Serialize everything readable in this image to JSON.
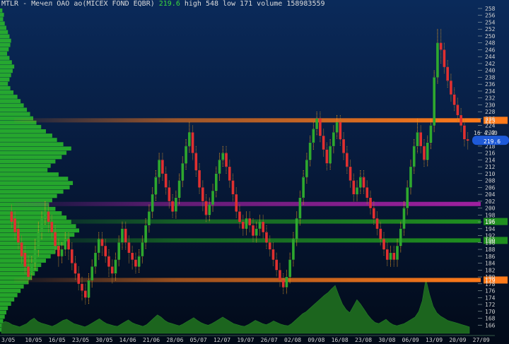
{
  "header": {
    "ticker": "MTLR",
    "name": "- Мечел ОАО ао(MICEX FOND EQBR)",
    "last": "219.6",
    "high": "high 548",
    "low": "low 171",
    "volume": "volume 158983559"
  },
  "colors": {
    "up": "#f0a020",
    "down": "#e03030",
    "line_orange": "#ff7a1a",
    "line_purple": "#a020a0",
    "line_green": "#1f8f1f",
    "volume_profile": "#2bbf2b",
    "volume_fill": "#1f6f1f",
    "axis_text": "#d0d0d0",
    "price_badge": "#1e5ad8"
  },
  "chart_data": {
    "type": "candlestick",
    "yaxis": {
      "min": 164,
      "max": 258,
      "ticks": [
        "166",
        "168",
        "170",
        "172",
        "174",
        "176",
        "178",
        "180",
        "182",
        "184",
        "186",
        "188",
        "190",
        "192",
        "194",
        "196",
        "198",
        "200",
        "202",
        "204",
        "206",
        "208",
        "210",
        "212",
        "214",
        "216",
        "218",
        "220",
        "222",
        "224",
        "226",
        "228",
        "230",
        "232",
        "234",
        "236",
        "238",
        "240",
        "242",
        "244",
        "246",
        "248",
        "250",
        "252",
        "254",
        "256",
        "258"
      ]
    },
    "xaxis": {
      "ticks": [
        "3/05",
        "10/05",
        "16/05",
        "23/05",
        "30/05",
        "14/06",
        "21/06",
        "28/06",
        "05/07",
        "12/07",
        "19/07",
        "26/07",
        "02/08",
        "09/08",
        "16/08",
        "23/08",
        "30/08",
        "06/09",
        "13/09",
        "20/09",
        "27/09"
      ]
    },
    "levels": [
      {
        "price": 225.5,
        "label": "225",
        "color": "orange"
      },
      {
        "price": 201.2,
        "label": "",
        "color": "purple"
      },
      {
        "price": 196.1,
        "label": "196",
        "color": "green"
      },
      {
        "price": 190.6,
        "label": "190",
        "color": "green"
      },
      {
        "price": 179.1,
        "label": "179",
        "color": "orange"
      }
    ],
    "last_price": "219.6",
    "price_badge_side_label": "16 4:40",
    "daily": [
      [
        199,
        196,
        201,
        194
      ],
      [
        197,
        193,
        199,
        191
      ],
      [
        194,
        190,
        196,
        188
      ],
      [
        190,
        186,
        192,
        184
      ],
      [
        187,
        183,
        189,
        181
      ],
      [
        183,
        180,
        186,
        178
      ],
      [
        181,
        184,
        186,
        179
      ],
      [
        184,
        188,
        191,
        182
      ],
      [
        188,
        193,
        196,
        186
      ],
      [
        193,
        197,
        199,
        191
      ],
      [
        197,
        199,
        202,
        195
      ],
      [
        199,
        196,
        201,
        193
      ],
      [
        196,
        193,
        198,
        191
      ],
      [
        193,
        189,
        195,
        187
      ],
      [
        189,
        186,
        191,
        183
      ],
      [
        186,
        188,
        190,
        184
      ],
      [
        188,
        191,
        193,
        186
      ],
      [
        191,
        188,
        193,
        185
      ],
      [
        188,
        184,
        190,
        182
      ],
      [
        184,
        181,
        186,
        179
      ],
      [
        181,
        178,
        183,
        176
      ],
      [
        178,
        176,
        180,
        173
      ],
      [
        176,
        174,
        178,
        172
      ],
      [
        174,
        179,
        181,
        172
      ],
      [
        179,
        183,
        185,
        177
      ],
      [
        183,
        187,
        189,
        181
      ],
      [
        187,
        191,
        193,
        185
      ],
      [
        191,
        189,
        193,
        186
      ],
      [
        189,
        186,
        191,
        184
      ],
      [
        186,
        183,
        188,
        180
      ],
      [
        183,
        181,
        185,
        178
      ],
      [
        181,
        185,
        187,
        179
      ],
      [
        185,
        190,
        192,
        183
      ],
      [
        190,
        194,
        196,
        188
      ],
      [
        194,
        190,
        196,
        188
      ],
      [
        190,
        187,
        192,
        184
      ],
      [
        187,
        185,
        189,
        182
      ],
      [
        185,
        183,
        187,
        181
      ],
      [
        183,
        186,
        188,
        181
      ],
      [
        186,
        190,
        192,
        184
      ],
      [
        190,
        195,
        197,
        188
      ],
      [
        195,
        199,
        201,
        193
      ],
      [
        199,
        204,
        206,
        197
      ],
      [
        204,
        209,
        211,
        202
      ],
      [
        209,
        214,
        216,
        207
      ],
      [
        214,
        210,
        216,
        208
      ],
      [
        210,
        206,
        212,
        204
      ],
      [
        206,
        202,
        208,
        200
      ],
      [
        202,
        199,
        204,
        197
      ],
      [
        199,
        203,
        205,
        197
      ],
      [
        203,
        208,
        210,
        201
      ],
      [
        208,
        213,
        215,
        206
      ],
      [
        213,
        218,
        220,
        211
      ],
      [
        218,
        222,
        225,
        216
      ],
      [
        222,
        216,
        224,
        214
      ],
      [
        216,
        211,
        218,
        209
      ],
      [
        211,
        206,
        213,
        204
      ],
      [
        206,
        202,
        208,
        199
      ],
      [
        202,
        198,
        204,
        196
      ],
      [
        198,
        201,
        203,
        196
      ],
      [
        201,
        205,
        207,
        199
      ],
      [
        205,
        210,
        212,
        203
      ],
      [
        210,
        214,
        216,
        208
      ],
      [
        214,
        216,
        218,
        212
      ],
      [
        216,
        212,
        218,
        210
      ],
      [
        212,
        208,
        214,
        206
      ],
      [
        208,
        204,
        210,
        202
      ],
      [
        204,
        199,
        206,
        197
      ],
      [
        199,
        196,
        201,
        194
      ],
      [
        196,
        194,
        198,
        192
      ],
      [
        194,
        197,
        199,
        192
      ],
      [
        197,
        195,
        199,
        193
      ],
      [
        195,
        192,
        197,
        190
      ],
      [
        192,
        194,
        196,
        190
      ],
      [
        194,
        196,
        198,
        192
      ],
      [
        196,
        193,
        198,
        191
      ],
      [
        193,
        190,
        195,
        188
      ],
      [
        190,
        188,
        192,
        186
      ],
      [
        188,
        185,
        190,
        183
      ],
      [
        185,
        182,
        187,
        180
      ],
      [
        182,
        179,
        184,
        177
      ],
      [
        179,
        177,
        181,
        175
      ],
      [
        177,
        180,
        182,
        175
      ],
      [
        180,
        185,
        187,
        178
      ],
      [
        185,
        191,
        193,
        183
      ],
      [
        191,
        197,
        199,
        189
      ],
      [
        197,
        203,
        205,
        195
      ],
      [
        203,
        209,
        211,
        201
      ],
      [
        209,
        214,
        216,
        207
      ],
      [
        214,
        219,
        221,
        212
      ],
      [
        219,
        223,
        225,
        217
      ],
      [
        223,
        226,
        228,
        221
      ],
      [
        226,
        221,
        228,
        219
      ],
      [
        221,
        217,
        223,
        215
      ],
      [
        217,
        213,
        219,
        211
      ],
      [
        213,
        218,
        220,
        211
      ],
      [
        218,
        222,
        224,
        216
      ],
      [
        222,
        225,
        227,
        220
      ],
      [
        225,
        220,
        227,
        218
      ],
      [
        220,
        216,
        222,
        214
      ],
      [
        216,
        212,
        218,
        210
      ],
      [
        212,
        208,
        214,
        206
      ],
      [
        208,
        204,
        210,
        202
      ],
      [
        204,
        206,
        208,
        202
      ],
      [
        206,
        209,
        211,
        204
      ],
      [
        209,
        206,
        211,
        204
      ],
      [
        206,
        203,
        208,
        201
      ],
      [
        203,
        200,
        205,
        198
      ],
      [
        200,
        197,
        202,
        195
      ],
      [
        197,
        194,
        199,
        192
      ],
      [
        194,
        191,
        196,
        189
      ],
      [
        191,
        188,
        193,
        186
      ],
      [
        188,
        185,
        190,
        183
      ],
      [
        185,
        187,
        189,
        183
      ],
      [
        187,
        185,
        189,
        183
      ],
      [
        185,
        189,
        191,
        183
      ],
      [
        189,
        194,
        196,
        187
      ],
      [
        194,
        200,
        202,
        192
      ],
      [
        200,
        206,
        208,
        198
      ],
      [
        206,
        212,
        214,
        204
      ],
      [
        212,
        218,
        220,
        210
      ],
      [
        218,
        222,
        226,
        216
      ],
      [
        222,
        218,
        224,
        216
      ],
      [
        218,
        214,
        220,
        212
      ],
      [
        214,
        219,
        221,
        212
      ],
      [
        219,
        224,
        226,
        217
      ],
      [
        224,
        238,
        240,
        222
      ],
      [
        238,
        248,
        252,
        236
      ],
      [
        248,
        246,
        252,
        242
      ],
      [
        246,
        241,
        248,
        239
      ],
      [
        241,
        237,
        243,
        235
      ],
      [
        237,
        233,
        239,
        231
      ],
      [
        233,
        230,
        235,
        228
      ],
      [
        230,
        227,
        232,
        225
      ],
      [
        227,
        224,
        229,
        222
      ],
      [
        224,
        220,
        226,
        218
      ],
      [
        220,
        219.6,
        222,
        217
      ]
    ],
    "volume_profile": [
      3,
      5,
      4,
      6,
      8,
      10,
      12,
      14,
      13,
      11,
      9,
      12,
      15,
      18,
      16,
      14,
      12,
      10,
      13,
      17,
      22,
      26,
      30,
      34,
      38,
      42,
      46,
      52,
      58,
      66,
      72,
      80,
      90,
      84,
      78,
      70,
      64,
      60,
      74,
      86,
      92,
      88,
      80,
      72,
      66,
      62,
      70,
      78,
      84,
      90,
      96,
      100,
      94,
      88,
      82,
      76,
      70,
      64,
      58,
      52,
      48,
      44,
      40,
      36,
      30,
      26,
      22,
      18,
      14,
      10,
      8,
      6,
      4,
      3,
      2
    ],
    "volume": [
      18,
      22,
      20,
      16,
      14,
      12,
      15,
      18,
      24,
      28,
      22,
      19,
      17,
      15,
      13,
      16,
      20,
      24,
      26,
      22,
      18,
      16,
      14,
      12,
      15,
      19,
      23,
      27,
      22,
      18,
      16,
      14,
      13,
      17,
      21,
      25,
      20,
      17,
      15,
      13,
      16,
      22,
      28,
      34,
      30,
      24,
      20,
      18,
      16,
      14,
      17,
      21,
      25,
      29,
      24,
      20,
      17,
      15,
      18,
      22,
      26,
      30,
      26,
      22,
      18,
      16,
      14,
      13,
      16,
      20,
      24,
      21,
      18,
      16,
      19,
      23,
      20,
      17,
      15,
      14,
      18,
      24,
      30,
      36,
      40,
      46,
      52,
      58,
      64,
      70,
      75,
      82,
      88,
      70,
      54,
      44,
      38,
      50,
      62,
      54,
      44,
      34,
      26,
      20,
      18,
      22,
      26,
      20,
      16,
      14,
      16,
      18,
      22,
      26,
      30,
      40,
      60,
      100,
      72,
      50,
      38,
      32,
      28,
      24,
      22,
      20,
      18,
      16,
      14,
      12
    ]
  }
}
